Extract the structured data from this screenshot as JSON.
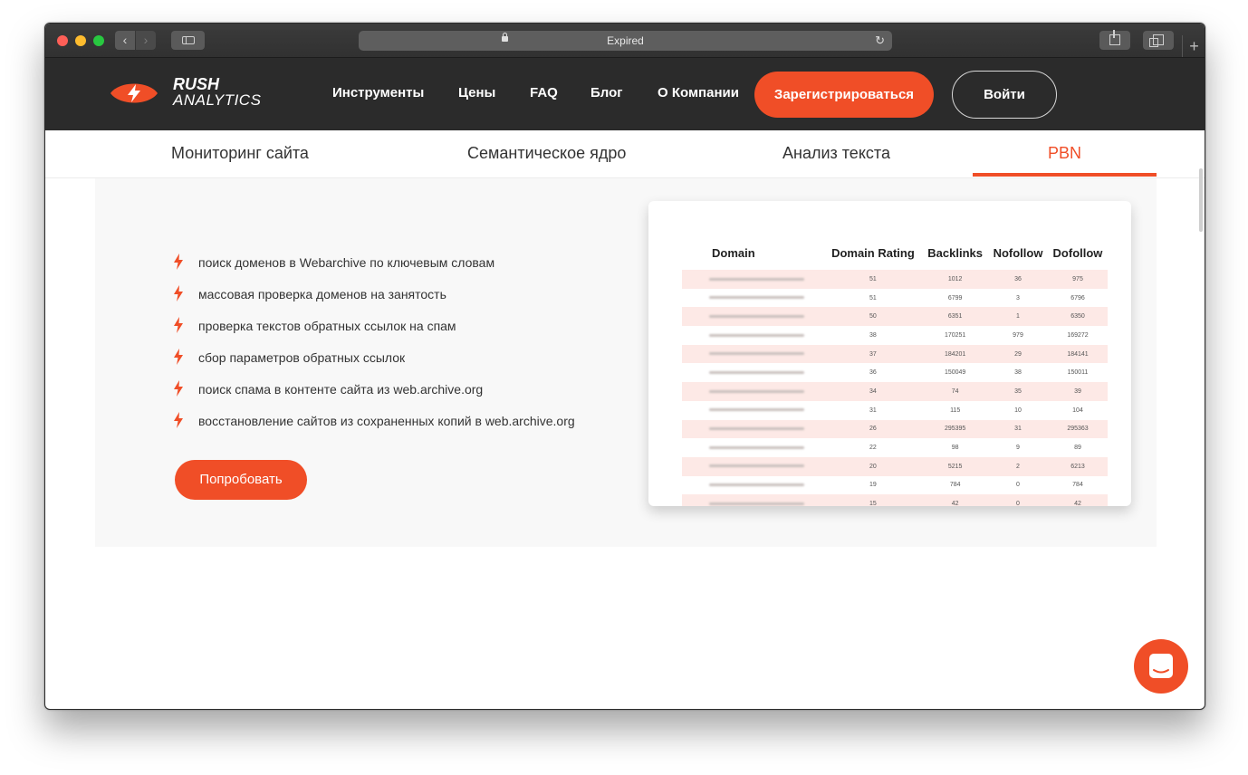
{
  "browser": {
    "url_text": "Expired",
    "back_glyph": "‹",
    "forward_glyph": "›",
    "reload_glyph": "↻",
    "newtab_glyph": "+"
  },
  "brand": {
    "line1": "RUSH",
    "line2": "ANALYTICS",
    "accent": "#f04e27"
  },
  "nav": {
    "links": [
      "Инструменты",
      "Цены",
      "FAQ",
      "Блог",
      "О Компании"
    ],
    "register_label": "Зарегистрироваться",
    "login_label": "Войти"
  },
  "tabs": [
    {
      "label": "Мониторинг сайта",
      "active": false
    },
    {
      "label": "Семантическое ядро",
      "active": false
    },
    {
      "label": "Анализ текста",
      "active": false
    },
    {
      "label": "PBN",
      "active": true
    }
  ],
  "features": [
    "поиск доменов в Webarchive по ключевым словам",
    "массовая проверка доменов на занятость",
    "проверка текстов обратных ссылок на спам",
    "сбор параметров обратных ссылок",
    "поиск спама в контенте сайта из web.archive.org",
    "восстановление сайтов из сохраненных копий в web.archive.org"
  ],
  "try_label": "Попробовать",
  "table": {
    "headers": [
      "Domain",
      "Domain Rating",
      "Backlinks",
      "Nofollow",
      "Dofollow"
    ],
    "rows": [
      [
        "51",
        "1012",
        "36",
        "975"
      ],
      [
        "51",
        "6799",
        "3",
        "6796"
      ],
      [
        "50",
        "6351",
        "1",
        "6350"
      ],
      [
        "38",
        "170251",
        "979",
        "169272"
      ],
      [
        "37",
        "184201",
        "29",
        "184141"
      ],
      [
        "36",
        "150049",
        "38",
        "150011"
      ],
      [
        "34",
        "74",
        "35",
        "39"
      ],
      [
        "31",
        "115",
        "10",
        "104"
      ],
      [
        "26",
        "295395",
        "31",
        "295363"
      ],
      [
        "22",
        "98",
        "9",
        "89"
      ],
      [
        "20",
        "5215",
        "2",
        "6213"
      ],
      [
        "19",
        "784",
        "0",
        "784"
      ],
      [
        "15",
        "42",
        "0",
        "42"
      ]
    ]
  },
  "icons": {
    "logo": "lightning-eye-icon",
    "bullet": "lightning-bolt-icon",
    "chat": "chat-bubble-icon"
  }
}
